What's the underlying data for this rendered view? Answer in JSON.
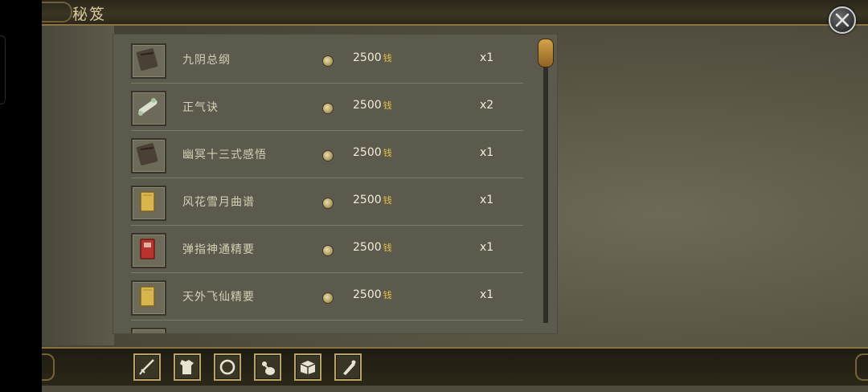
{
  "window": {
    "title": "秘笈"
  },
  "items": [
    {
      "name": "九阴总纲",
      "price": "2500",
      "currency": "钱",
      "qty": "x1",
      "icon": "dark-book-icon",
      "icon_color": "#4a4136"
    },
    {
      "name": "正气诀",
      "price": "2500",
      "currency": "钱",
      "qty": "x2",
      "icon": "scroll-icon",
      "icon_color": "#d9e0cf"
    },
    {
      "name": "幽冥十三式感悟",
      "price": "2500",
      "currency": "钱",
      "qty": "x1",
      "icon": "dark-book-icon",
      "icon_color": "#4a4136"
    },
    {
      "name": "风花雪月曲谱",
      "price": "2500",
      "currency": "钱",
      "qty": "x1",
      "icon": "yellow-book-icon",
      "icon_color": "#d8b54e"
    },
    {
      "name": "弹指神通精要",
      "price": "2500",
      "currency": "钱",
      "qty": "x1",
      "icon": "red-book-icon",
      "icon_color": "#b8322e"
    },
    {
      "name": "天外飞仙精要",
      "price": "2500",
      "currency": "钱",
      "qty": "x1",
      "icon": "yellow-book-icon",
      "icon_color": "#d8b54e"
    }
  ],
  "tabs": [
    {
      "name": "weapon-tab",
      "icon": "sword-icon"
    },
    {
      "name": "armor-tab",
      "icon": "clothing-icon"
    },
    {
      "name": "ring-tab",
      "icon": "ring-icon"
    },
    {
      "name": "potion-tab",
      "icon": "gourd-icon"
    },
    {
      "name": "book-tab",
      "icon": "book-icon"
    },
    {
      "name": "scroll-tab",
      "icon": "scroll-icon"
    }
  ],
  "colors": {
    "accent_gold": "#8a7440",
    "currency_yellow": "#e0c24a",
    "panel": "#5c5a4c"
  }
}
